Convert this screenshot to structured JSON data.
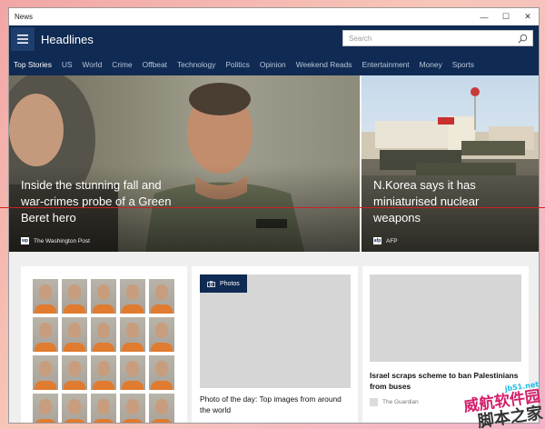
{
  "window": {
    "title": "News"
  },
  "window_controls": {
    "minimize": "—",
    "maximize": "☐",
    "close": "✕"
  },
  "appbar": {
    "title": "Headlines"
  },
  "search": {
    "placeholder": "Search"
  },
  "tabs": [
    {
      "label": "Top Stories",
      "active": true
    },
    {
      "label": "US"
    },
    {
      "label": "World"
    },
    {
      "label": "Crime"
    },
    {
      "label": "Offbeat"
    },
    {
      "label": "Technology"
    },
    {
      "label": "Politics"
    },
    {
      "label": "Opinion"
    },
    {
      "label": "Weekend Reads"
    },
    {
      "label": "Entertainment"
    },
    {
      "label": "Money"
    },
    {
      "label": "Sports"
    }
  ],
  "hero": {
    "main": {
      "headline_lines": [
        "Inside the stunning fall and",
        "war-crimes probe of a Green",
        "Beret hero"
      ],
      "source": "The Washington Post",
      "source_logo": "wp"
    },
    "side": {
      "headline_lines": [
        "N.Korea says it has",
        "miniaturised nuclear",
        "weapons"
      ],
      "source": "AFP",
      "source_logo": "afp"
    }
  },
  "cards": {
    "photos": {
      "badge": "Photos",
      "title_lines": [
        "Photo of the day: Top images from around",
        "the world"
      ]
    },
    "article": {
      "title_lines": [
        "Israel scraps scheme to ban Palestinians",
        "from buses"
      ],
      "source": "The Guardian"
    }
  },
  "watermark": {
    "line1": "jb51.net",
    "line2": "威航软件园",
    "line3": "脚本之家"
  },
  "colors": {
    "appbar": "#0f2a53",
    "accent_red": "#d02020"
  }
}
